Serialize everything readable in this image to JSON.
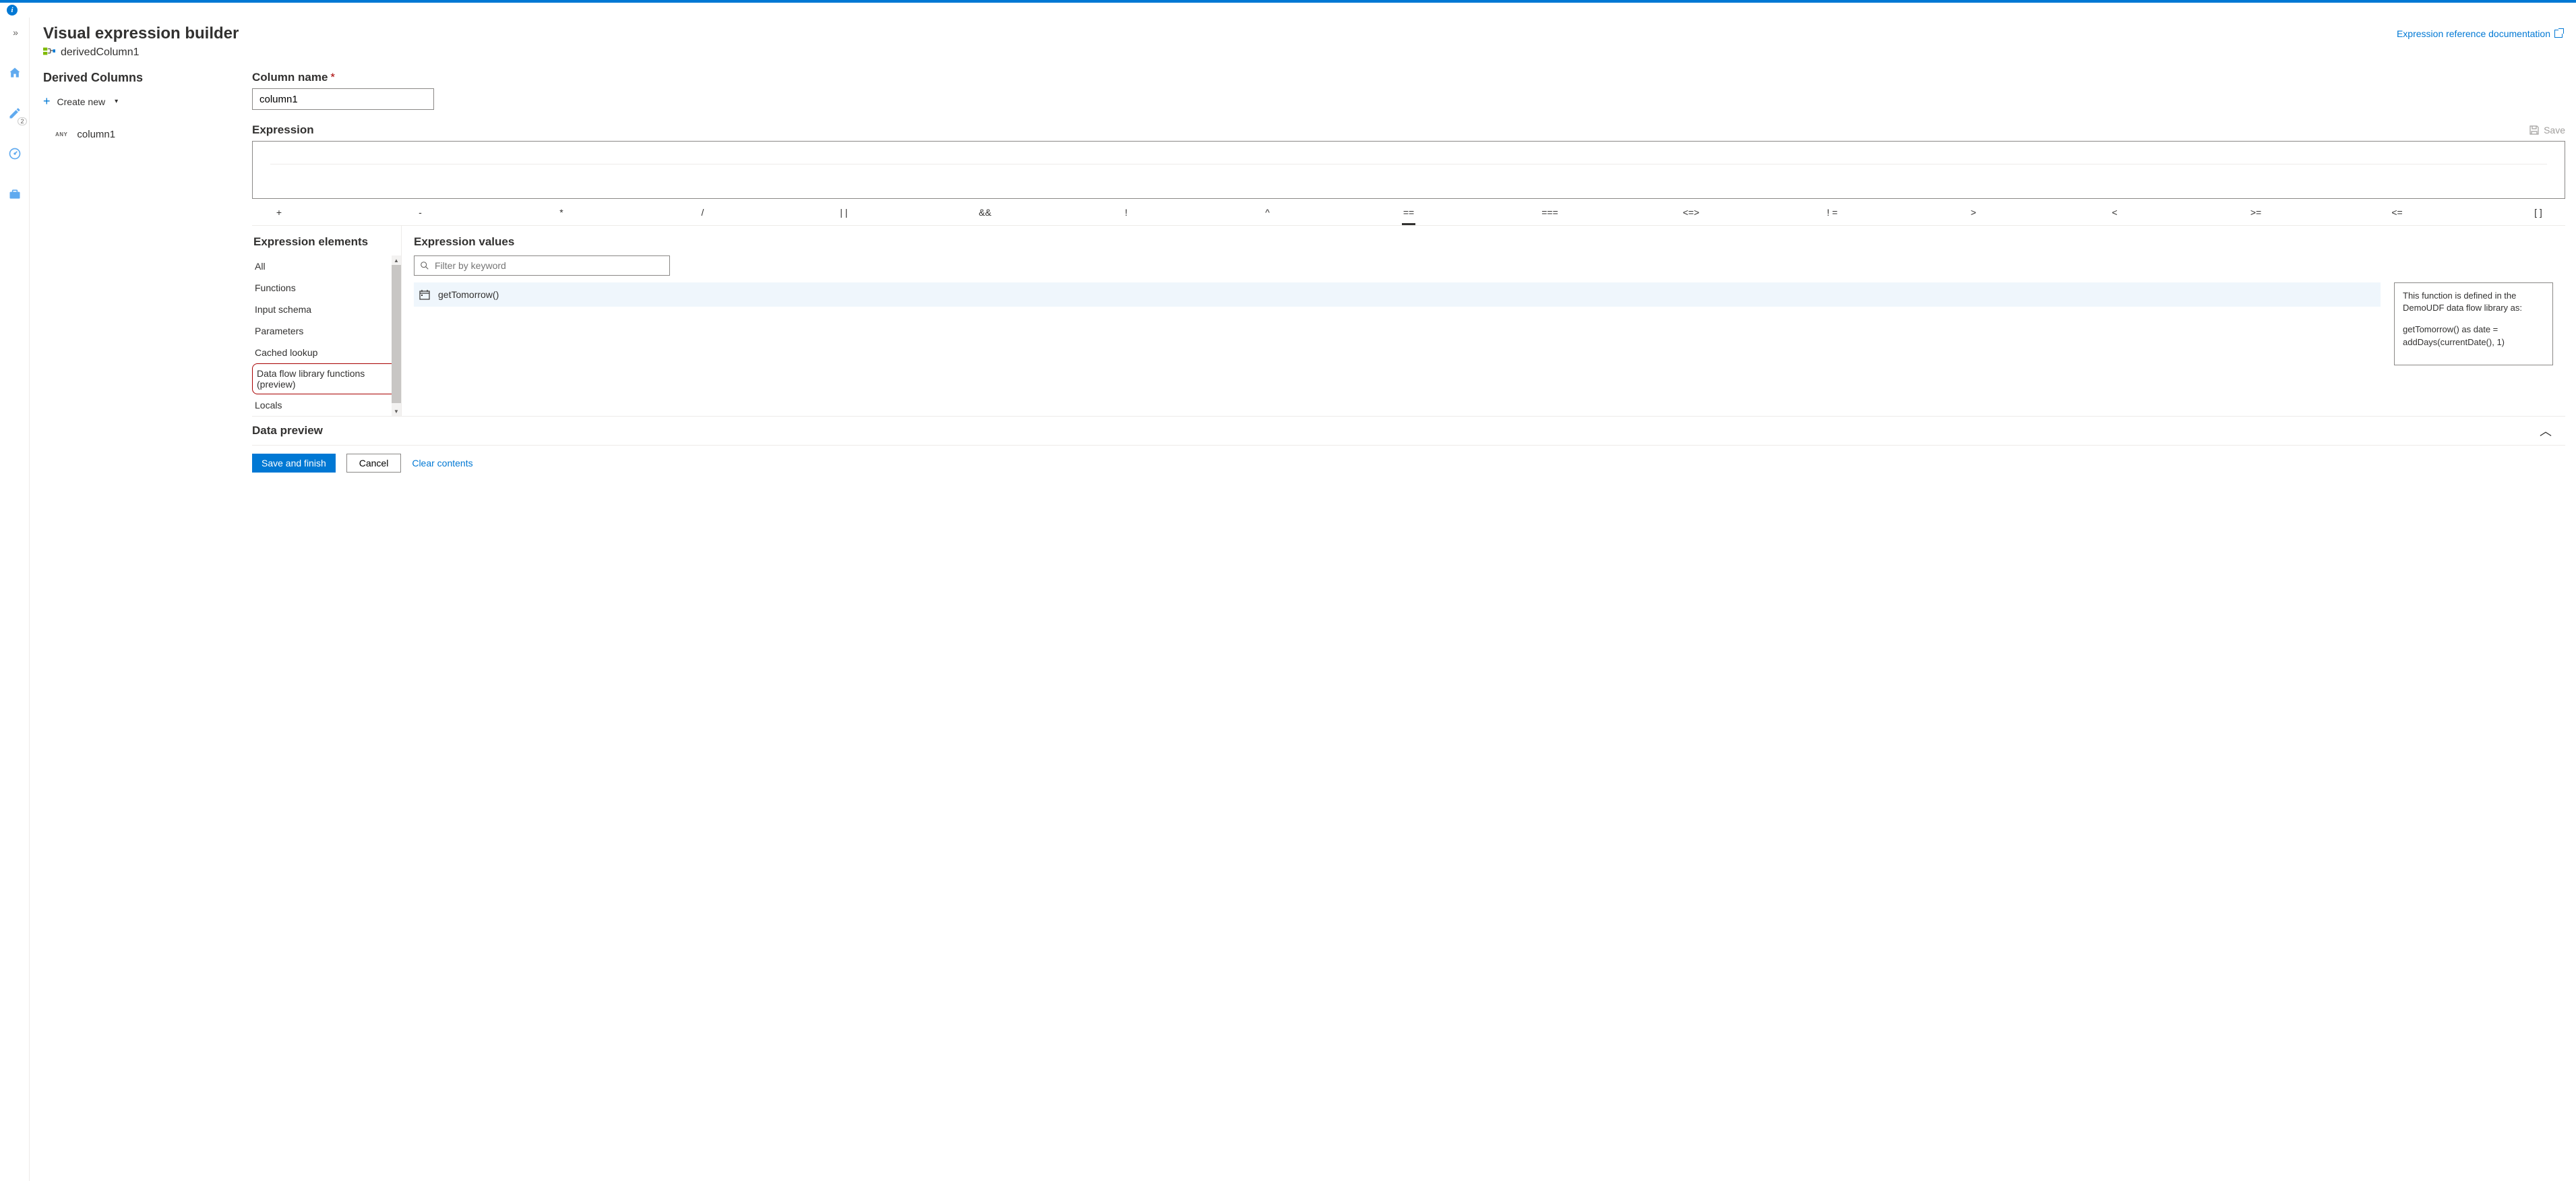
{
  "header": {
    "title": "Visual expression builder",
    "doc_link": "Expression reference documentation",
    "breadcrumb": "derivedColumn1"
  },
  "left_rail": {
    "badge_count": "2"
  },
  "derived_columns": {
    "heading": "Derived Columns",
    "create_new": "Create new",
    "items": [
      {
        "type": "ANY",
        "name": "column1"
      }
    ]
  },
  "column_form": {
    "name_label": "Column name",
    "name_value": "column1",
    "expression_label": "Expression",
    "save_label": "Save"
  },
  "operators": [
    "+",
    "-",
    "*",
    "/",
    "| |",
    "&&",
    "!",
    "^",
    "==",
    "===",
    "<=>",
    "! =",
    ">",
    "<",
    ">=",
    "<=",
    "[ ]"
  ],
  "expression_elements": {
    "title": "Expression elements",
    "items": [
      "All",
      "Functions",
      "Input schema",
      "Parameters",
      "Cached lookup",
      "Data flow library functions (preview)",
      "Locals"
    ],
    "selected_index": 5
  },
  "expression_values": {
    "title": "Expression values",
    "filter_placeholder": "Filter by keyword",
    "list": [
      {
        "icon": "calendar",
        "label": "getTomorrow()"
      }
    ],
    "tooltip": {
      "line1": "This function is defined in the DemoUDF data flow library as:",
      "line2": "getTomorrow() as date = addDays(currentDate(), 1)"
    }
  },
  "data_preview": {
    "title": "Data preview"
  },
  "footer": {
    "save_finish": "Save and finish",
    "cancel": "Cancel",
    "clear": "Clear contents"
  }
}
